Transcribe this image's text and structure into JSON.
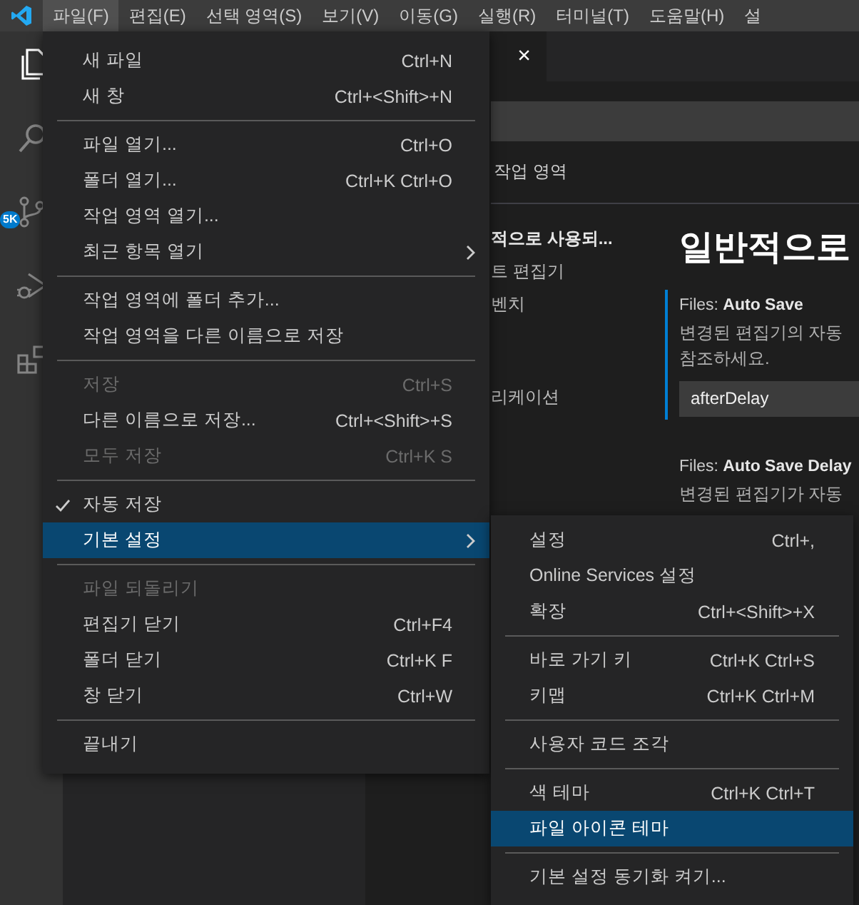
{
  "menubar": {
    "items": [
      {
        "label": "파일(F)",
        "selected": true
      },
      {
        "label": "편집(E)",
        "selected": false
      },
      {
        "label": "선택 영역(S)",
        "selected": false
      },
      {
        "label": "보기(V)",
        "selected": false
      },
      {
        "label": "이동(G)",
        "selected": false
      },
      {
        "label": "실행(R)",
        "selected": false
      },
      {
        "label": "터미널(T)",
        "selected": false
      },
      {
        "label": "도움말(H)",
        "selected": false
      },
      {
        "label": "설",
        "selected": false
      }
    ]
  },
  "activity_bar": {
    "items": [
      {
        "kind": "files",
        "selected": true
      },
      {
        "kind": "search",
        "selected": false
      },
      {
        "kind": "source-control",
        "selected": false,
        "badge": "5K"
      },
      {
        "kind": "run",
        "selected": false
      },
      {
        "kind": "extensions",
        "selected": false
      }
    ]
  },
  "editor_tab": {
    "close": "×"
  },
  "settings_editor": {
    "tab": "작업 영역",
    "toc": [
      {
        "label": "적으로 사용되...",
        "selected": true
      },
      {
        "label": "트 편집기",
        "selected": false
      },
      {
        "label": "벤치",
        "selected": false
      },
      {
        "label": "리케이션",
        "selected": false
      }
    ],
    "heading": "일반적으로",
    "settings": [
      {
        "title": "Files: **Auto Save**",
        "description": [
          "변경된 편집기의 자동",
          "참조하세요."
        ],
        "value": "afterDelay",
        "focused": true
      },
      {
        "title": "Files: **Auto Save Delay**",
        "description": [
          "변경된 편집기가 자동"
        ],
        "focused": false
      }
    ]
  },
  "file_menu": {
    "items": [
      {
        "kind": "item",
        "label": "새 파일",
        "shortcut": "Ctrl+N",
        "disabled": false,
        "checked": false,
        "selected": false,
        "submenu": false
      },
      {
        "kind": "item",
        "label": "새 창",
        "shortcut": "Ctrl+<Shift>+N",
        "disabled": false,
        "checked": false,
        "selected": false,
        "submenu": false
      },
      {
        "kind": "separator"
      },
      {
        "kind": "item",
        "label": "파일 열기...",
        "shortcut": "Ctrl+O",
        "disabled": false,
        "checked": false,
        "selected": false,
        "submenu": false
      },
      {
        "kind": "item",
        "label": "폴더 열기...",
        "shortcut": "Ctrl+K Ctrl+O",
        "disabled": false,
        "checked": false,
        "selected": false,
        "submenu": false
      },
      {
        "kind": "item",
        "label": "작업 영역 열기...",
        "disabled": false,
        "checked": false,
        "selected": false,
        "submenu": false
      },
      {
        "kind": "item",
        "label": "최근 항목 열기",
        "disabled": false,
        "checked": false,
        "selected": false,
        "submenu": true
      },
      {
        "kind": "separator"
      },
      {
        "kind": "item",
        "label": "작업 영역에 폴더 추가...",
        "disabled": false,
        "checked": false,
        "selected": false,
        "submenu": false
      },
      {
        "kind": "item",
        "label": "작업 영역을 다른 이름으로 저장",
        "disabled": false,
        "checked": false,
        "selected": false,
        "submenu": false
      },
      {
        "kind": "separator"
      },
      {
        "kind": "item",
        "label": "저장",
        "shortcut": "Ctrl+S",
        "disabled": true,
        "checked": false,
        "selected": false,
        "submenu": false
      },
      {
        "kind": "item",
        "label": "다른 이름으로 저장...",
        "shortcut": "Ctrl+<Shift>+S",
        "disabled": false,
        "checked": false,
        "selected": false,
        "submenu": false
      },
      {
        "kind": "item",
        "label": "모두 저장",
        "shortcut": "Ctrl+K S",
        "disabled": true,
        "checked": false,
        "selected": false,
        "submenu": false
      },
      {
        "kind": "separator"
      },
      {
        "kind": "item",
        "label": "자동 저장",
        "disabled": false,
        "checked": true,
        "selected": false,
        "submenu": false
      },
      {
        "kind": "item",
        "label": "기본 설정",
        "disabled": false,
        "checked": false,
        "selected": true,
        "submenu": true
      },
      {
        "kind": "separator"
      },
      {
        "kind": "item",
        "label": "파일 되돌리기",
        "disabled": true,
        "checked": false,
        "selected": false,
        "submenu": false
      },
      {
        "kind": "item",
        "label": "편집기 닫기",
        "shortcut": "Ctrl+F4",
        "disabled": false,
        "checked": false,
        "selected": false,
        "submenu": false
      },
      {
        "kind": "item",
        "label": "폴더 닫기",
        "shortcut": "Ctrl+K F",
        "disabled": false,
        "checked": false,
        "selected": false,
        "submenu": false
      },
      {
        "kind": "item",
        "label": "창 닫기",
        "shortcut": "Ctrl+W",
        "disabled": false,
        "checked": false,
        "selected": false,
        "submenu": false
      },
      {
        "kind": "separator"
      },
      {
        "kind": "item",
        "label": "끝내기",
        "disabled": false,
        "checked": false,
        "selected": false,
        "submenu": false
      }
    ]
  },
  "preferences_submenu": {
    "items": [
      {
        "kind": "item",
        "label": "설정",
        "shortcut": "Ctrl+,",
        "disabled": false,
        "checked": false,
        "selected": false,
        "submenu": false
      },
      {
        "kind": "item",
        "label": "Online Services 설정",
        "disabled": false,
        "checked": false,
        "selected": false,
        "submenu": false
      },
      {
        "kind": "item",
        "label": "확장",
        "shortcut": "Ctrl+<Shift>+X",
        "disabled": false,
        "checked": false,
        "selected": false,
        "submenu": false
      },
      {
        "kind": "separator"
      },
      {
        "kind": "item",
        "label": "바로 가기 키",
        "shortcut": "Ctrl+K Ctrl+S",
        "disabled": false,
        "checked": false,
        "selected": false,
        "submenu": false
      },
      {
        "kind": "item",
        "label": "키맵",
        "shortcut": "Ctrl+K Ctrl+M",
        "disabled": false,
        "checked": false,
        "selected": false,
        "submenu": false
      },
      {
        "kind": "separator"
      },
      {
        "kind": "item",
        "label": "사용자 코드 조각",
        "disabled": false,
        "checked": false,
        "selected": false,
        "submenu": false
      },
      {
        "kind": "separator"
      },
      {
        "kind": "item",
        "label": "색 테마",
        "shortcut": "Ctrl+K Ctrl+T",
        "disabled": false,
        "checked": false,
        "selected": false,
        "submenu": false
      },
      {
        "kind": "item",
        "label": "파일 아이콘 테마",
        "disabled": false,
        "checked": false,
        "selected": true,
        "submenu": false
      },
      {
        "kind": "separator"
      },
      {
        "kind": "item",
        "label": "기본 설정 동기화 켜기...",
        "disabled": false,
        "checked": false,
        "selected": false,
        "submenu": false
      }
    ]
  }
}
